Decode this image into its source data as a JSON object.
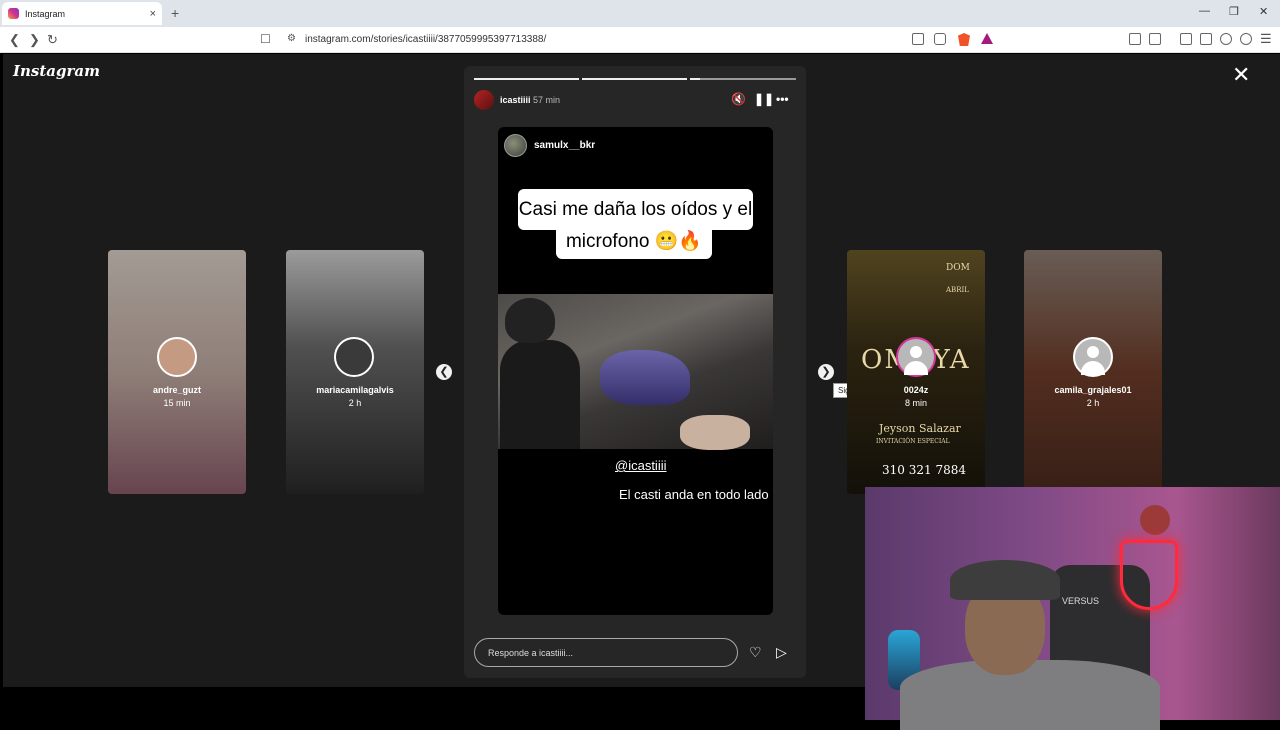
{
  "browser": {
    "tab_title": "Instagram",
    "tab_close": "×",
    "new_tab": "+",
    "url": "instagram.com/stories/icastiiii/3877059995397713388/"
  },
  "instagram": {
    "logo": "Instagram",
    "close": "✕"
  },
  "story": {
    "username": "icastiiii",
    "time": "57 min",
    "inner_username": "samulx__bkr",
    "caption_line1": "Casi me daña los oídos y el",
    "caption_line2": "microfono 😬🔥",
    "mention": "@icastiiii",
    "inner_caption": "El casti anda en todo lado",
    "reply_placeholder": "Responde a icastiiii..."
  },
  "side_stories": [
    {
      "name": "andre_guzt",
      "time": "15 min"
    },
    {
      "name": "mariacamilagalvis",
      "time": "2 h"
    },
    {
      "name": "0024z",
      "time": "8 min"
    },
    {
      "name": "camila_grajales01",
      "time": "2 h"
    }
  ],
  "poster": {
    "title": "OMAYA",
    "dom": "DOM",
    "abril": "ABRIL",
    "name": "Jeyson Salazar",
    "subtitle": "INVITACIÓN ESPECIAL",
    "phone": "310 321 7884"
  },
  "tooltip": "Siguiente",
  "webcam": {
    "chair_brand": "VERSUS"
  },
  "colors": {
    "viewer_bg": "#1b1b1b",
    "panel_bg": "#262626",
    "neon": "#ff2a3c"
  }
}
